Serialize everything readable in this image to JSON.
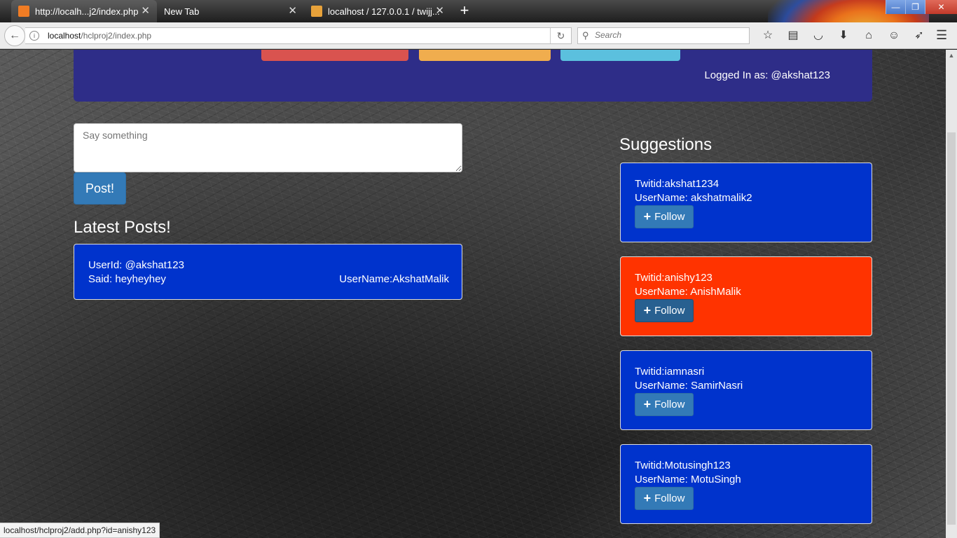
{
  "browser": {
    "tabs": [
      {
        "label": "http://localh...j2/index.php",
        "active": true
      },
      {
        "label": "New Tab",
        "active": false
      },
      {
        "label": "localhost / 127.0.0.1 / twijj...",
        "active": false
      }
    ],
    "url_host": "localhost",
    "url_path": "/hclproj2/index.php",
    "search_placeholder": "Search",
    "new_tab_symbol": "+",
    "status_url": "localhost/hclproj2/add.php?id=anishy123"
  },
  "header": {
    "logged_in": "Logged In as: @akshat123"
  },
  "composer": {
    "placeholder": "Say something",
    "post_label": "Post!"
  },
  "latest": {
    "title": "Latest Posts!",
    "posts": [
      {
        "userid": "UserId: @akshat123",
        "said": "Said: heyheyhey",
        "username": "UserName:AkshatMalik"
      }
    ]
  },
  "suggestions": {
    "title": "Suggestions",
    "follow_label": "Follow",
    "items": [
      {
        "twitid": "Twitid:akshat1234",
        "username": "UserName: akshatmalik2",
        "color": "#0033cc"
      },
      {
        "twitid": "Twitid:anishy123",
        "username": "UserName: AnishMalik",
        "color": "#ff3300"
      },
      {
        "twitid": "Twitid:iamnasri",
        "username": "UserName: SamirNasri",
        "color": "#0033cc"
      },
      {
        "twitid": "Twitid:Motusingh123",
        "username": "UserName: MotuSingh",
        "color": "#0033cc"
      }
    ]
  },
  "colors": {
    "header_bg": "#2e2d88",
    "post_btn": "#337ab7",
    "card_blue": "#0033cc",
    "card_orange": "#ff3300"
  },
  "icons": [
    "back-arrow-icon",
    "info-icon",
    "reload-icon",
    "search-icon",
    "bookmark-star-icon",
    "reading-list-icon",
    "pocket-icon",
    "download-icon",
    "home-icon",
    "smiley-icon",
    "share-icon",
    "hamburger-menu-icon",
    "plus-icon"
  ]
}
